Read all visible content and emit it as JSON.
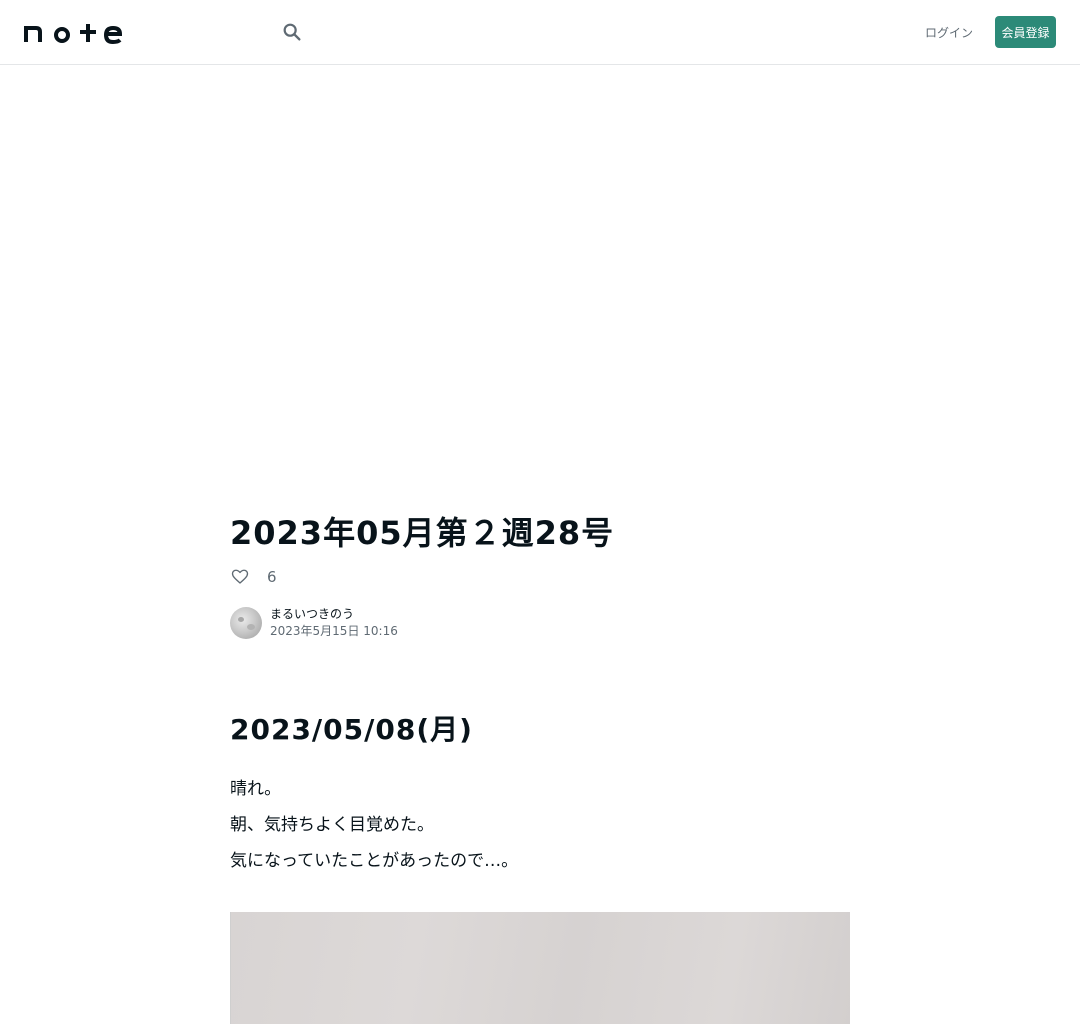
{
  "header": {
    "logo_text": "note",
    "search_icon": "search-icon",
    "login_label": "ログイン",
    "signup_label": "会員登録",
    "accent_color": "#2c8a78"
  },
  "article": {
    "title": "2023年05月第２週28号",
    "like_icon": "heart-icon",
    "like_count": "6",
    "author_name": "まるいつきのう",
    "post_date": "2023年5月15日 10:16",
    "heading": "2023/05/08(月)",
    "paragraphs": [
      "晴れ。",
      "朝、気持ちよく目覚めた。",
      "気になっていたことがあったので…。"
    ]
  }
}
